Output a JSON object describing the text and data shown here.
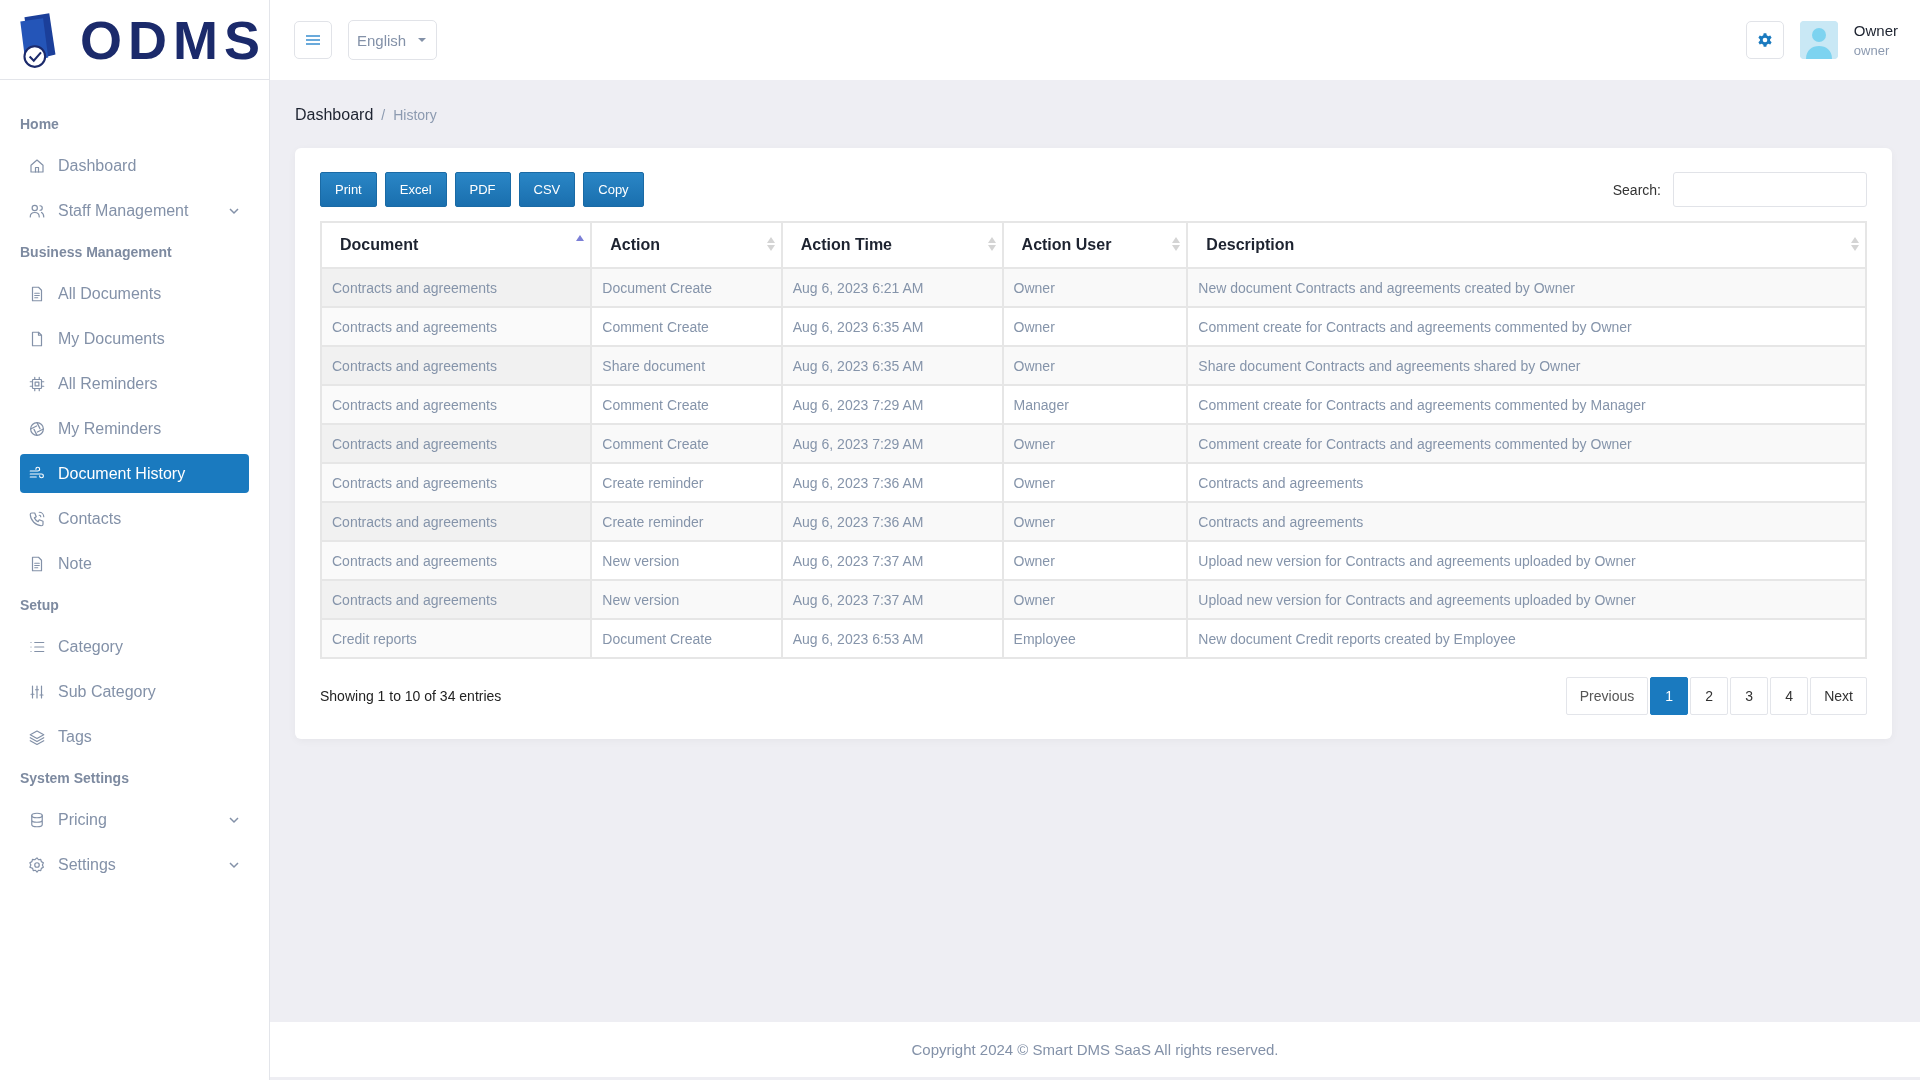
{
  "logo": {
    "text": "ODMS"
  },
  "header": {
    "language": "English",
    "user": {
      "name": "Owner",
      "role": "owner"
    }
  },
  "sidebar": {
    "items": [
      {
        "kind": "heading",
        "label": "Home"
      },
      {
        "kind": "item",
        "label": "Dashboard",
        "selected": false,
        "expandable": false
      },
      {
        "kind": "item",
        "label": "Staff Management",
        "selected": false,
        "expandable": true
      },
      {
        "kind": "heading",
        "label": "Business Management"
      },
      {
        "kind": "item",
        "label": "All Documents",
        "selected": false,
        "expandable": false
      },
      {
        "kind": "item",
        "label": "My Documents",
        "selected": false,
        "expandable": false
      },
      {
        "kind": "item",
        "label": "All Reminders",
        "selected": false,
        "expandable": false
      },
      {
        "kind": "item",
        "label": "My Reminders",
        "selected": false,
        "expandable": false
      },
      {
        "kind": "item",
        "label": "Document History",
        "selected": true,
        "expandable": false
      },
      {
        "kind": "item",
        "label": "Contacts",
        "selected": false,
        "expandable": false
      },
      {
        "kind": "item",
        "label": "Note",
        "selected": false,
        "expandable": false
      },
      {
        "kind": "heading",
        "label": "Setup"
      },
      {
        "kind": "item",
        "label": "Category",
        "selected": false,
        "expandable": false
      },
      {
        "kind": "item",
        "label": "Sub Category",
        "selected": false,
        "expandable": false
      },
      {
        "kind": "item",
        "label": "Tags",
        "selected": false,
        "expandable": false
      },
      {
        "kind": "heading",
        "label": "System Settings"
      },
      {
        "kind": "item",
        "label": "Pricing",
        "selected": false,
        "expandable": true
      },
      {
        "kind": "item",
        "label": "Settings",
        "selected": false,
        "expandable": true
      }
    ]
  },
  "breadcrumb": [
    "Dashboard",
    "History"
  ],
  "breadcrumb_separator": "/",
  "export_buttons": [
    "Print",
    "Excel",
    "PDF",
    "CSV",
    "Copy"
  ],
  "search": {
    "label": "Search:"
  },
  "table": {
    "columns": [
      {
        "label": "Document",
        "sorted": true
      },
      {
        "label": "Action",
        "sorted": false
      },
      {
        "label": "Action Time",
        "sorted": false
      },
      {
        "label": "Action User",
        "sorted": false
      },
      {
        "label": "Description",
        "sorted": false
      }
    ],
    "rows": [
      [
        "Contracts and agreements",
        "Document Create",
        "Aug 6, 2023 6:21 AM",
        "Owner",
        "New document Contracts and agreements created by Owner"
      ],
      [
        "Contracts and agreements",
        "Comment Create",
        "Aug 6, 2023 6:35 AM",
        "Owner",
        "Comment create for Contracts and agreements commented by Owner"
      ],
      [
        "Contracts and agreements",
        "Share document",
        "Aug 6, 2023 6:35 AM",
        "Owner",
        "Share document Contracts and agreements shared by Owner"
      ],
      [
        "Contracts and agreements",
        "Comment Create",
        "Aug 6, 2023 7:29 AM",
        "Manager",
        "Comment create for Contracts and agreements commented by Manager"
      ],
      [
        "Contracts and agreements",
        "Comment Create",
        "Aug 6, 2023 7:29 AM",
        "Owner",
        "Comment create for Contracts and agreements commented by Owner"
      ],
      [
        "Contracts and agreements",
        "Create reminder",
        "Aug 6, 2023 7:36 AM",
        "Owner",
        "Contracts and agreements"
      ],
      [
        "Contracts and agreements",
        "Create reminder",
        "Aug 6, 2023 7:36 AM",
        "Owner",
        "Contracts and agreements"
      ],
      [
        "Contracts and agreements",
        "New version",
        "Aug 6, 2023 7:37 AM",
        "Owner",
        "Upload new version for Contracts and agreements uploaded by Owner"
      ],
      [
        "Contracts and agreements",
        "New version",
        "Aug 6, 2023 7:37 AM",
        "Owner",
        "Upload new version for Contracts and agreements uploaded by Owner"
      ],
      [
        "Credit reports",
        "Document Create",
        "Aug 6, 2023 6:53 AM",
        "Employee",
        "New document Credit reports created by Employee"
      ]
    ]
  },
  "info": "Showing 1 to 10 of 34 entries",
  "pagination": {
    "previous": "Previous",
    "next": "Next",
    "pages": [
      {
        "label": "1",
        "selected": true
      },
      {
        "label": "2",
        "selected": false
      },
      {
        "label": "3",
        "selected": false
      },
      {
        "label": "4",
        "selected": false
      }
    ]
  },
  "footer": "Copyright 2024 © Smart DMS SaaS All rights reserved."
}
